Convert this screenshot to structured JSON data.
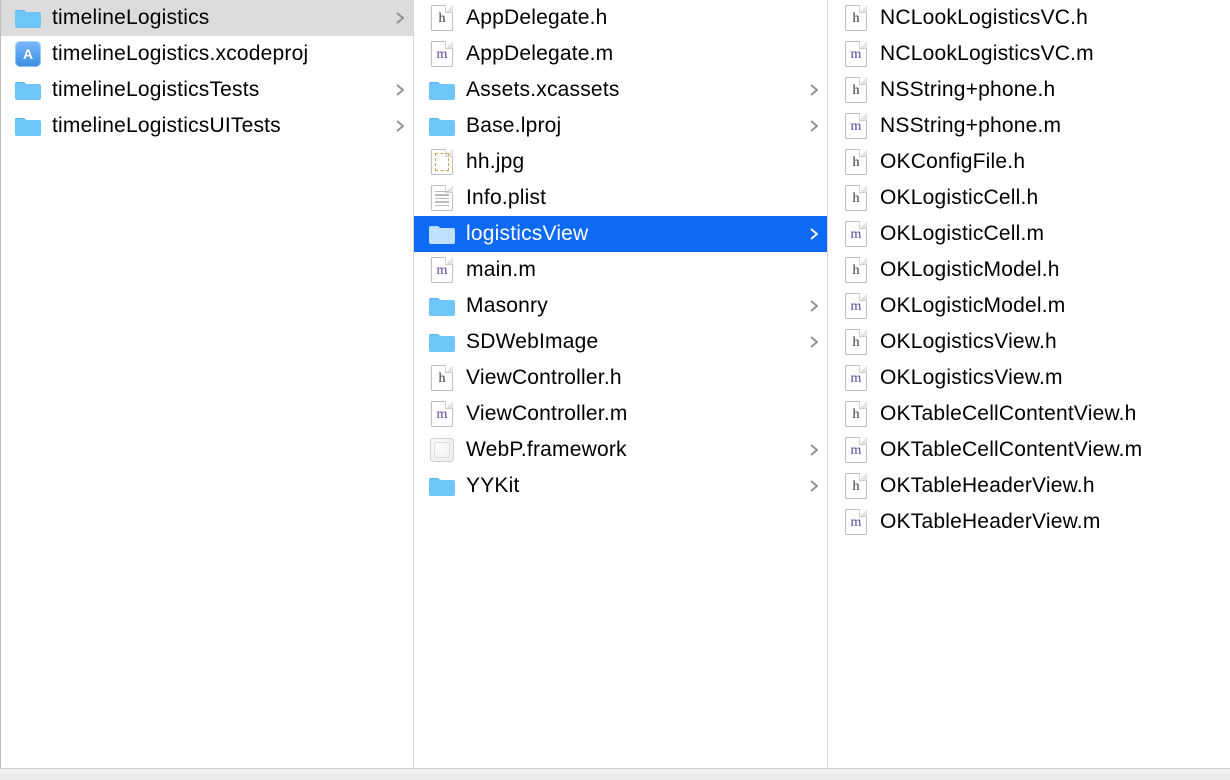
{
  "columns": [
    {
      "id": "col1",
      "items": [
        {
          "name": "timelineLogistics",
          "icon": "folder",
          "hasChildren": true,
          "selected": "grey"
        },
        {
          "name": "timelineLogistics.xcodeproj",
          "icon": "xcodeproj",
          "hasChildren": false
        },
        {
          "name": "timelineLogisticsTests",
          "icon": "folder",
          "hasChildren": true
        },
        {
          "name": "timelineLogisticsUITests",
          "icon": "folder",
          "hasChildren": true
        }
      ]
    },
    {
      "id": "col2",
      "items": [
        {
          "name": "AppDelegate.h",
          "icon": "h",
          "hasChildren": false
        },
        {
          "name": "AppDelegate.m",
          "icon": "m",
          "hasChildren": false
        },
        {
          "name": "Assets.xcassets",
          "icon": "folder",
          "hasChildren": true
        },
        {
          "name": "Base.lproj",
          "icon": "folder",
          "hasChildren": true
        },
        {
          "name": "hh.jpg",
          "icon": "jpg",
          "hasChildren": false
        },
        {
          "name": "Info.plist",
          "icon": "plist",
          "hasChildren": false
        },
        {
          "name": "logisticsView",
          "icon": "folder",
          "hasChildren": true,
          "selected": "blue"
        },
        {
          "name": "main.m",
          "icon": "m",
          "hasChildren": false
        },
        {
          "name": "Masonry",
          "icon": "folder",
          "hasChildren": true
        },
        {
          "name": "SDWebImage",
          "icon": "folder",
          "hasChildren": true
        },
        {
          "name": "ViewController.h",
          "icon": "h",
          "hasChildren": false
        },
        {
          "name": "ViewController.m",
          "icon": "m",
          "hasChildren": false
        },
        {
          "name": "WebP.framework",
          "icon": "framework",
          "hasChildren": true
        },
        {
          "name": "YYKit",
          "icon": "folder",
          "hasChildren": true
        }
      ]
    },
    {
      "id": "col3",
      "items": [
        {
          "name": "NCLookLogisticsVC.h",
          "icon": "h",
          "hasChildren": false
        },
        {
          "name": "NCLookLogisticsVC.m",
          "icon": "m",
          "hasChildren": false
        },
        {
          "name": "NSString+phone.h",
          "icon": "h",
          "hasChildren": false
        },
        {
          "name": "NSString+phone.m",
          "icon": "m",
          "hasChildren": false
        },
        {
          "name": "OKConfigFile.h",
          "icon": "h",
          "hasChildren": false
        },
        {
          "name": "OKLogisticCell.h",
          "icon": "h",
          "hasChildren": false
        },
        {
          "name": "OKLogisticCell.m",
          "icon": "m",
          "hasChildren": false
        },
        {
          "name": "OKLogisticModel.h",
          "icon": "h",
          "hasChildren": false
        },
        {
          "name": "OKLogisticModel.m",
          "icon": "m",
          "hasChildren": false
        },
        {
          "name": "OKLogisticsView.h",
          "icon": "h",
          "hasChildren": false
        },
        {
          "name": "OKLogisticsView.m",
          "icon": "m",
          "hasChildren": false
        },
        {
          "name": "OKTableCellContentView.h",
          "icon": "h",
          "hasChildren": false
        },
        {
          "name": "OKTableCellContentView.m",
          "icon": "m",
          "hasChildren": false
        },
        {
          "name": "OKTableHeaderView.h",
          "icon": "h",
          "hasChildren": false
        },
        {
          "name": "OKTableHeaderView.m",
          "icon": "m",
          "hasChildren": false
        }
      ]
    }
  ]
}
